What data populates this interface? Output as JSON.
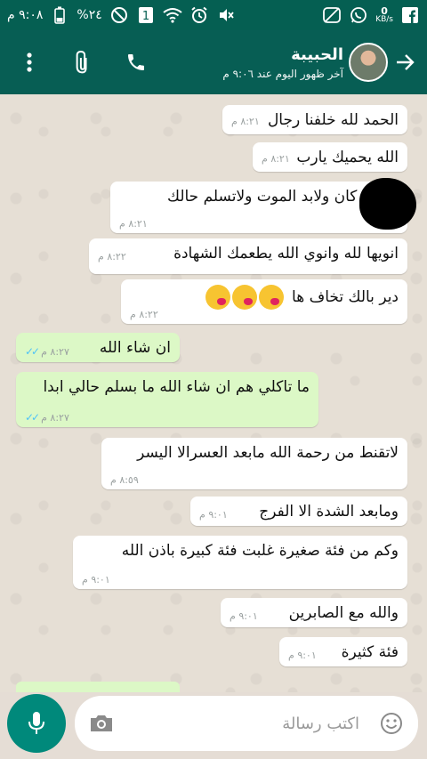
{
  "statusbar": {
    "time": "٩:٠٨ م",
    "battery": "%٢٤",
    "network_badge": "1",
    "speed_value": "0",
    "speed_unit": "KB/s",
    "icons": [
      "battery-icon",
      "block-icon",
      "sim-icon",
      "wifi-icon",
      "alarm-icon",
      "mute-icon",
      "nfc-icon",
      "whatsapp-icon",
      "facebook-icon"
    ]
  },
  "header": {
    "contact_name": "الحبيبة",
    "last_seen": "آخر ظهور اليوم عند ٩:٠٦ م",
    "actions": [
      "more-icon",
      "attach-icon",
      "call-icon"
    ]
  },
  "messages": [
    {
      "dir": "in",
      "text": "الحمد لله خلفنا رجال",
      "time": "٨:٢١ م"
    },
    {
      "dir": "in",
      "text": "الله يحميك يارب",
      "time": "٨:٢١ م"
    },
    {
      "dir": "in",
      "text": "ان كان ولابد الموت ولاتسلم حالك",
      "time": "٨:٢١ م"
    },
    {
      "dir": "in",
      "text": "انويها لله وانوي الله يطعمك الشهادة",
      "time": "٨:٢٢ م"
    },
    {
      "dir": "in",
      "text": "دير بالك تخاف ها",
      "time": "٨:٢٢ م"
    },
    {
      "dir": "out",
      "text": "ان شاء الله",
      "time": "٨:٢٧ م"
    },
    {
      "dir": "out",
      "text": "ما تاكلي هم ان شاء الله ما بسلم حالي ابدا",
      "time": "٨:٢٧ م"
    },
    {
      "dir": "in",
      "text": "لاتقنط من رحمة الله مابعد العسرالا اليسر",
      "time": "٨:٥٩ م"
    },
    {
      "dir": "in",
      "text": "ومابعد الشدة الا الفرج",
      "time": "٩:٠١ م"
    },
    {
      "dir": "in",
      "text": "وكم من فئة صغيرة غلبت فئة كبيرة باذن الله",
      "time": "٩:٠١ م"
    },
    {
      "dir": "in",
      "text": "والله مع الصابرين",
      "time": "٩:٠١ م"
    },
    {
      "dir": "in",
      "text": "فئة كثيرة",
      "time": "٩:٠١ م"
    }
  ],
  "composer": {
    "placeholder": "اكتب رسالة"
  },
  "colors": {
    "header": "#075e54",
    "statusbar": "#055f52",
    "outgoing_bubble": "#dcf8c6",
    "incoming_bubble": "#ffffff",
    "mic_button": "#00897b"
  }
}
